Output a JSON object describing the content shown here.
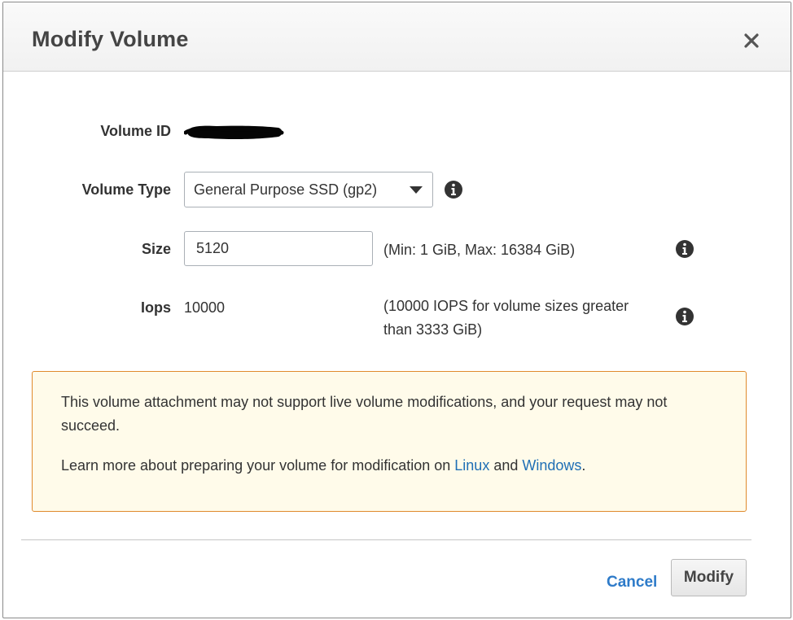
{
  "dialog": {
    "title": "Modify Volume",
    "close_icon": "close-icon"
  },
  "form": {
    "volume_id": {
      "label": "Volume ID",
      "value_redacted": true
    },
    "volume_type": {
      "label": "Volume Type",
      "selected": "General Purpose SSD (gp2)",
      "icon": "info-icon"
    },
    "size": {
      "label": "Size",
      "value": "5120",
      "hint": "(Min: 1 GiB, Max: 16384 GiB)",
      "icon": "info-icon"
    },
    "iops": {
      "label": "Iops",
      "value": "10000",
      "hint": "(10000 IOPS for volume sizes greater than 3333 GiB)",
      "icon": "info-icon"
    }
  },
  "alert": {
    "message": "This volume attachment may not support live volume modifications, and your request may not succeed.",
    "learn_more_prefix": "Learn more about preparing your volume for modification on ",
    "link_linux": "Linux",
    "and_text": " and ",
    "link_windows": "Windows",
    "suffix": ".",
    "border_color": "#e08a2c",
    "background_color": "#fffbea"
  },
  "footer": {
    "cancel_label": "Cancel",
    "modify_label": "Modify"
  }
}
